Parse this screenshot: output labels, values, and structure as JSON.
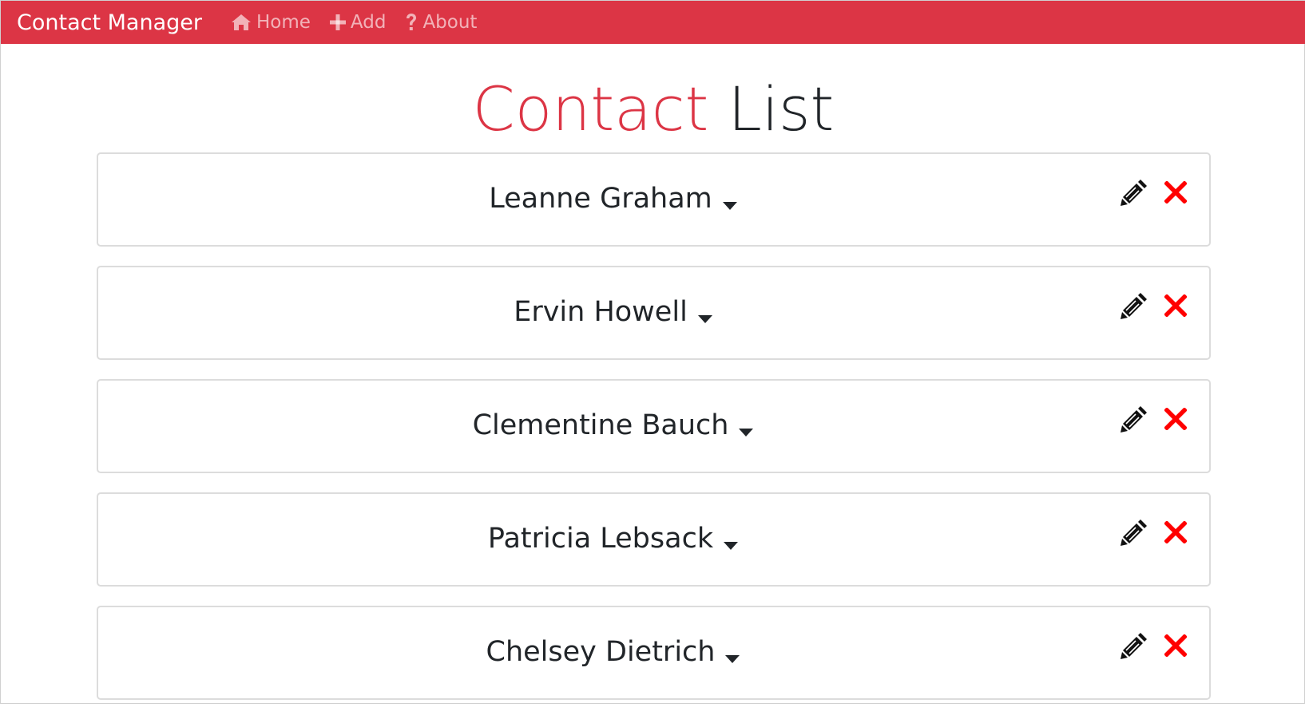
{
  "navbar": {
    "brand": "Contact Manager",
    "links": [
      {
        "label": "Home",
        "icon": "home-icon"
      },
      {
        "label": "Add",
        "icon": "plus-icon"
      },
      {
        "label": "About",
        "icon": "question-icon"
      }
    ]
  },
  "page": {
    "title_accent": "Contact",
    "title_rest": "List"
  },
  "contacts": [
    {
      "name": "Leanne Graham"
    },
    {
      "name": "Ervin Howell"
    },
    {
      "name": "Clementine Bauch"
    },
    {
      "name": "Patricia Lebsack"
    },
    {
      "name": "Chelsey Dietrich"
    }
  ],
  "icons": {
    "expand": "caret-down-icon",
    "edit": "pencil-icon",
    "delete": "close-icon"
  },
  "colors": {
    "brand": "#dc3545",
    "delete": "#ff0000",
    "text": "#212529"
  }
}
